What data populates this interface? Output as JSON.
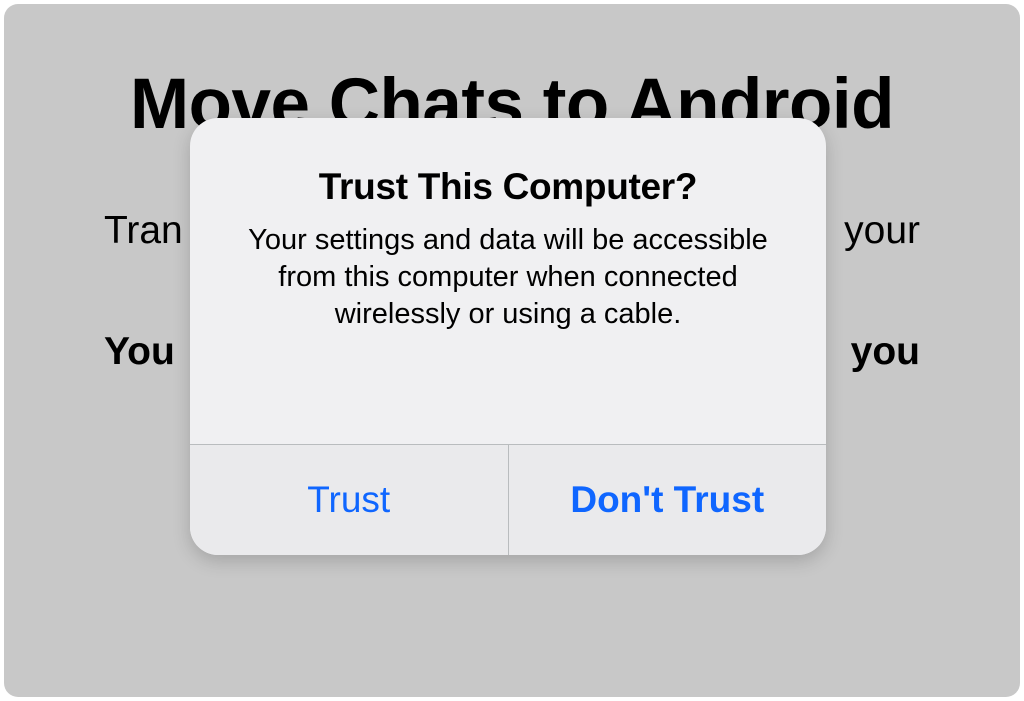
{
  "background": {
    "title": "Move Chats to Android",
    "line1_left": "Tran",
    "line1_right": "your",
    "line2_left": "You",
    "line2_right": "you"
  },
  "dialog": {
    "title": "Trust This Computer?",
    "message": "Your settings and data will be accessible from this computer when connected wirelessly or using a cable.",
    "trust_label": "Trust",
    "dont_trust_label": "Don't Trust"
  }
}
